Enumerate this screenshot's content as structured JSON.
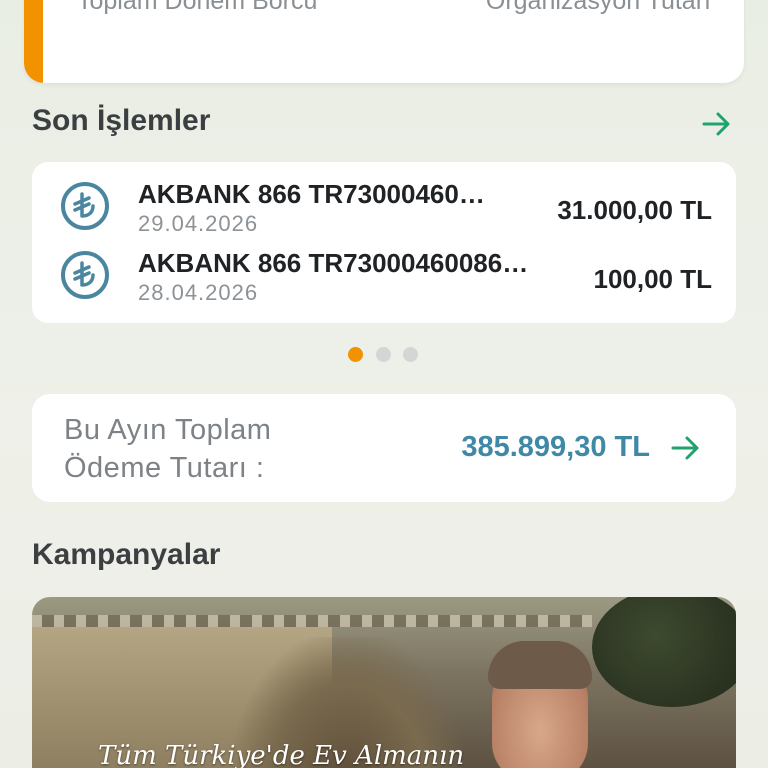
{
  "summary": {
    "left_label": "Toplam Dönem Borcu",
    "right_label": "Organizasyon Tutarı"
  },
  "recent": {
    "title": "Son İşlemler",
    "transactions": [
      {
        "name": "AKBANK 866 TR73000460…",
        "date": "29.04.2026",
        "amount": "31.000,00 TL"
      },
      {
        "name": "AKBANK 866 TR73000460086…",
        "date": "28.04.2026",
        "amount": "100,00 TL"
      }
    ],
    "pager": {
      "count": 3,
      "active": 1
    }
  },
  "monthly_total": {
    "label_line1": "Bu Ayın Toplam",
    "label_line2": "Ödeme Tutarı :",
    "amount": "385.899,30 TL"
  },
  "campaigns": {
    "title": "Kampanyalar",
    "banner_text": "Tüm Türkiye'de Ev Almanın"
  },
  "icons": {
    "transaction": "lira-icon",
    "navigate": "arrow-right-icon"
  },
  "colors": {
    "accent_orange": "#f39200",
    "arrow_green": "#1ea36b",
    "amount_blue": "#3f88a6",
    "lira_icon": "#4a86a0"
  }
}
